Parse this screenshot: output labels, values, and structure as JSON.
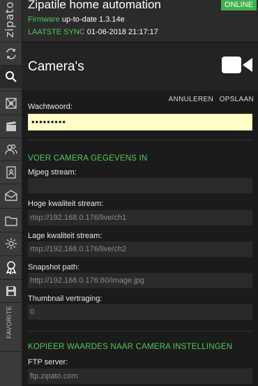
{
  "sidebar": {
    "brand": "zipato",
    "favorite_label": "FAVORITE",
    "items": [
      {
        "name": "sync-icon"
      },
      {
        "name": "search-icon"
      },
      {
        "name": "network-icon"
      },
      {
        "name": "clapper-icon"
      },
      {
        "name": "users-icon"
      },
      {
        "name": "phone-book-icon"
      },
      {
        "name": "mail-icon"
      },
      {
        "name": "folder-icon"
      },
      {
        "name": "gear-icon"
      },
      {
        "name": "award-icon"
      },
      {
        "name": "floppy-icon"
      }
    ]
  },
  "header": {
    "app_title": "Zipatile home automation",
    "status": "ONLINE",
    "firmware_label": "Firmware",
    "firmware_value": "up-to-date 1.3.14e",
    "sync_label": "LAATSTE SYNC",
    "sync_value": "01-06-2018 21:17:17"
  },
  "page": {
    "title": "Camera's",
    "cancel_label": "ANNULEREN",
    "save_label": "OPSLAAN"
  },
  "form": {
    "password_label": "Wachtwoord:",
    "password_value": "•••••••••",
    "section1": "VOER CAMERA GEGEVENS IN",
    "mjpeg_label": "Mjpeg stream:",
    "mjpeg_value": "",
    "high_label": "Hoge kwaliteit stream:",
    "high_value": "rtsp://192.168.0.176/live/ch1",
    "low_label": "Lage kwaliteit stream:",
    "low_value": "rtsp://192.168.0.176/live/ch2",
    "snapshot_label": "Snapshot path:",
    "snapshot_value": "http://192.168.0.176:80/image.jpg",
    "thumb_label": "Thumbnail vertraging:",
    "thumb_value": "0",
    "section2": "KOPIEER WAARDES NAAR CAMERA INSTELLINGEN",
    "ftp_label": "FTP server:",
    "ftp_value": "ftp.zipato.com"
  },
  "colors": {
    "accent_green": "#4ec95a",
    "online_green": "#3fb14e",
    "password_bg": "#ffffc8"
  }
}
